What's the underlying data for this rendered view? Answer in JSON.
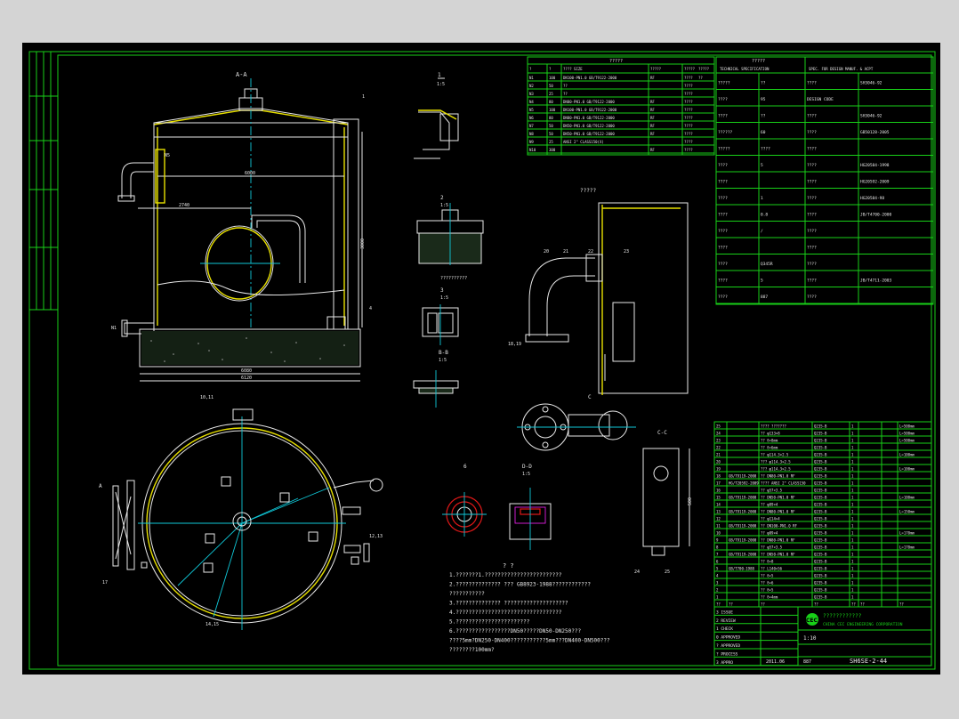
{
  "drawing": {
    "view_aa": "A-A",
    "view_bb": "B-B",
    "view_cc": "C-C",
    "view_dd": "D-D",
    "scale_15": "1:5",
    "label_a": "A",
    "label_c": "C",
    "dim_height": "3000",
    "dim_width": "6000",
    "dim_total": "6120",
    "dim_tank_inner": "6080",
    "dim_nozzle": "2740",
    "dim_base": "300",
    "dim_cc_height": "500"
  },
  "top_table": {
    "title": "?????",
    "header": [
      "?",
      "?",
      "???? SIZE",
      "?????",
      "?????",
      "?????"
    ],
    "rows": [
      [
        "N1",
        "100",
        "DN100-PN1.0 GB/T9122-2000",
        "RF",
        "????",
        "??"
      ],
      [
        "N2",
        "50",
        "??",
        "",
        "????",
        ""
      ],
      [
        "N3",
        "25",
        "??",
        "",
        "????",
        ""
      ],
      [
        "N4",
        "80",
        "DN80-PN1.0 GB/T9122-2000",
        "RF",
        "????",
        ""
      ],
      [
        "N5",
        "100",
        "DN100-PN1.0 GB/T9122-2000",
        "RF",
        "????",
        ""
      ],
      [
        "N6",
        "80",
        "DN80-PN1.0 GB/T9122-2000",
        "RF",
        "????",
        ""
      ],
      [
        "N7",
        "50",
        "DN50-PN1.0 GB/T9122-2000",
        "RF",
        "????",
        ""
      ],
      [
        "N8",
        "50",
        "DN50-PN1.0 GB/T9122-2000",
        "RF",
        "????",
        ""
      ],
      [
        "N9",
        "25",
        "ANSI 2\" CLASS150(X)",
        "",
        "????",
        ""
      ],
      [
        "N10",
        "300",
        "",
        "RF",
        "????",
        ""
      ]
    ]
  },
  "design_spec": {
    "title": "?????",
    "col1": "TECHNICAL SPECIFICATION",
    "col2": "SPEC. FOR DESIGN MANUF. & ACPT",
    "rows": [
      [
        "?????",
        "??",
        "????",
        "SH3046-92"
      ],
      [
        "????",
        "95",
        "DESIGN CODE",
        ""
      ],
      [
        "????",
        "??",
        "????",
        "SH3046-92"
      ],
      [
        "??????",
        "60",
        "????",
        "GB50128-2005"
      ],
      [
        "?????",
        "????",
        "????",
        ""
      ],
      [
        "????",
        "5",
        "????",
        "HG20584-1998"
      ],
      [
        "????",
        "",
        "????",
        "HG20592-2009"
      ],
      [
        "????",
        "1",
        "????",
        "HG20584-98"
      ],
      [
        "????",
        "0.8",
        "????",
        "JB/T4700-2000"
      ],
      [
        "????",
        "/",
        "????",
        ""
      ],
      [
        "????",
        "",
        "????",
        ""
      ],
      [
        "????",
        "Q345R",
        "????",
        ""
      ],
      [
        "????",
        "5",
        "????",
        "JB/T4711-2003"
      ],
      [
        "????",
        "887",
        "????",
        ""
      ]
    ]
  },
  "parts_list": {
    "header": [
      "??",
      "??",
      "??",
      "??",
      "??",
      "??",
      "??"
    ],
    "rows": [
      [
        "25",
        "",
        "???? ???????",
        "Q235-B",
        "1",
        "",
        "L=500mm"
      ],
      [
        "24",
        "",
        "?? φ133×8",
        "Q235-B",
        "1",
        "",
        "L=500mm"
      ],
      [
        "23",
        "",
        "?? δ=8mm",
        "Q235-B",
        "1",
        "",
        "L=500mm"
      ],
      [
        "22",
        "",
        "?? δ=6mm",
        "Q235-B",
        "1",
        "",
        ""
      ],
      [
        "21",
        "",
        "?? φ114.3×2.5",
        "Q235-B",
        "1",
        "",
        "L=100mm"
      ],
      [
        "20",
        "",
        "??? φ114.3×2.5",
        "Q235-B",
        "1",
        "",
        ""
      ],
      [
        "19",
        "",
        "??? φ114.3×2.5",
        "Q235-B",
        "1",
        "",
        "L=100mm"
      ],
      [
        "18",
        "GB/T9119-2000",
        "?? DN80-PN1.0 RF",
        "Q235-B",
        "1",
        "",
        ""
      ],
      [
        "17",
        "HG/T20592-2009",
        "???? ANSI 2\" CLASS150",
        "Q235-B",
        "1",
        "",
        ""
      ],
      [
        "16",
        "",
        "?? φ57×3.5",
        "Q235-B",
        "1",
        "",
        ""
      ],
      [
        "15",
        "GB/T9119-2000",
        "?? DN50-PN1.0 RF",
        "Q235-B",
        "1",
        "",
        "L=100mm"
      ],
      [
        "14",
        "",
        "?? φ89×4",
        "Q235-B",
        "1",
        "",
        ""
      ],
      [
        "13",
        "GB/T9119-2000",
        "?? DN80-PN1.0 RF",
        "Q235-B",
        "1",
        "",
        "L=150mm"
      ],
      [
        "12",
        "",
        "?? φ114×4",
        "Q235-B",
        "1",
        "",
        ""
      ],
      [
        "11",
        "GB/T9119-2000",
        "?? DN100-PN1.0 RF",
        "Q235-B",
        "1",
        "",
        ""
      ],
      [
        "10",
        "",
        "?? φ89×4",
        "Q235-B",
        "1",
        "",
        "L=170mm"
      ],
      [
        "9",
        "GB/T9119-2000",
        "?? DN80-PN1.0 RF",
        "Q235-B",
        "1",
        "",
        ""
      ],
      [
        "8",
        "",
        "?? φ57×3.5",
        "Q235-B",
        "1",
        "",
        "L=170mm"
      ],
      [
        "7",
        "GB/T9119-2000",
        "?? DN50-PN1.0 RF",
        "Q235-B",
        "1",
        "",
        ""
      ],
      [
        "6",
        "",
        "?? δ=8",
        "Q235-B",
        "1",
        "",
        ""
      ],
      [
        "5",
        "GB/T700-1988",
        "?? L140×56",
        "Q235-B",
        "1",
        "",
        ""
      ],
      [
        "4",
        "",
        "?? δ=5",
        "Q235-B",
        "1",
        "",
        ""
      ],
      [
        "3",
        "",
        "?? δ=6",
        "Q235-B",
        "1",
        "",
        ""
      ],
      [
        "2",
        "",
        "?? δ=5",
        "Q235-B",
        "1",
        "",
        ""
      ],
      [
        "1",
        "",
        "?? δ=4mm",
        "Q235-B",
        "1",
        "",
        ""
      ]
    ]
  },
  "notes": {
    "title": "?  ?",
    "lines": [
      "1.???????1.????????????????????????",
      "2.?????????????? ??? GB8923-1988????????????",
      "   ???????????",
      "3.?????????????? ????????????????????",
      "4.?????????????????????????????????",
      "5.???????????????????????",
      "6.?????????????????DN50?????DN50-DN250???",
      "   ????5mm?DN250-DN400???????????5mm???DN400-DN500???",
      "   ????????100mm?"
    ]
  },
  "title_block": {
    "company_cn": "????????????",
    "company_en": "CHINA CEC ENGINEERING CORPORATION",
    "logo": "CEC",
    "scale": "1:10",
    "drawing_no": "SH6SE-2-44",
    "date": "2011.06",
    "sheet": "887",
    "revisions": [
      "3 ISSUE",
      "2 REVIEW",
      "1 CHECK",
      "0 APPROVED",
      "? APPROVED",
      "? PROCESS",
      "3 APPRO"
    ]
  },
  "colors": {
    "frame": "#18d018",
    "outline": "#e8e8e8",
    "shell": "#e8e000",
    "center": "#10c8d8",
    "section": "#e01818"
  }
}
